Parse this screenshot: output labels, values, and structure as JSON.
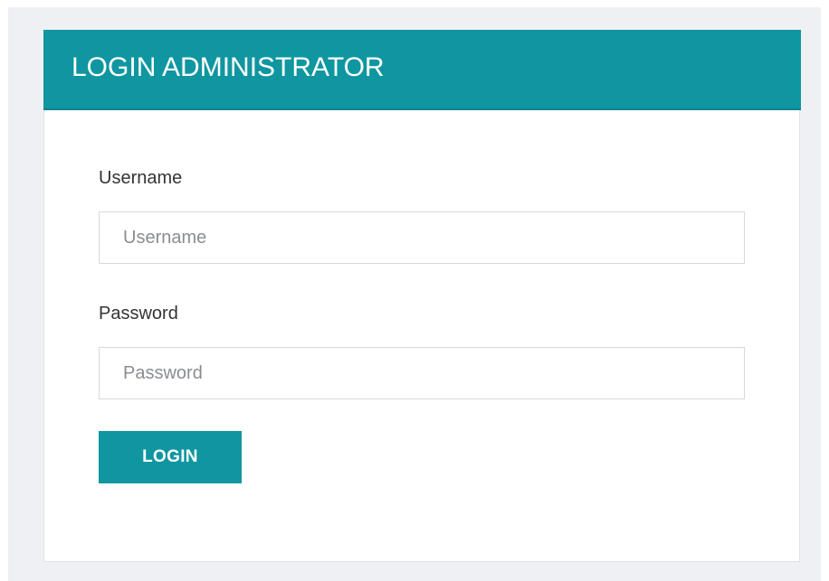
{
  "login_panel": {
    "title": "LOGIN ADMINISTRATOR",
    "username": {
      "label": "Username",
      "placeholder": "Username",
      "value": ""
    },
    "password": {
      "label": "Password",
      "placeholder": "Password",
      "value": ""
    },
    "submit_label": "LOGIN"
  },
  "colors": {
    "accent": "#0f96a0",
    "page_background": "#eff0f4",
    "panel_background": "#ffffff",
    "input_border": "#d6d9dd"
  }
}
